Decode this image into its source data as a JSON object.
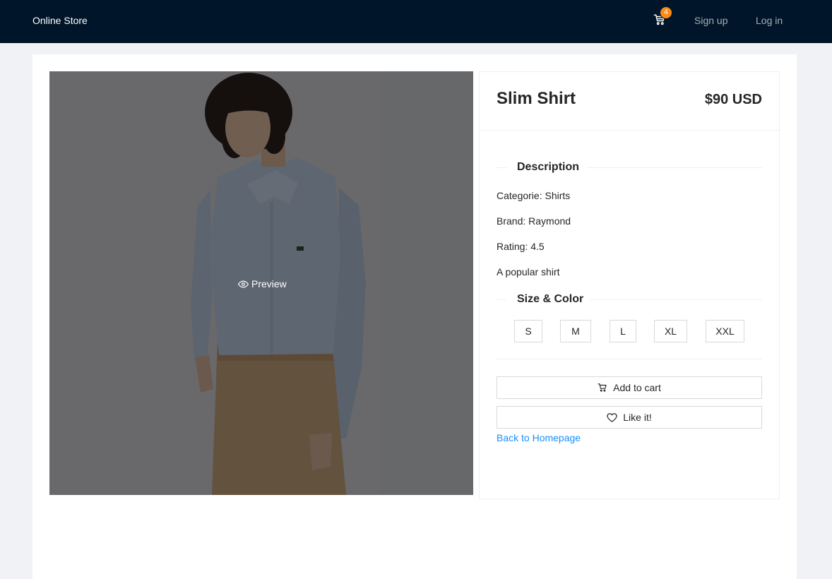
{
  "header": {
    "brand": "Online Store",
    "cart_count": "4",
    "signup_label": "Sign up",
    "login_label": "Log in"
  },
  "product": {
    "preview_label": "Preview",
    "title": "Slim Shirt",
    "price": "$90 USD",
    "description_heading": "Description",
    "category": "Categorie: Shirts",
    "brand": "Brand: Raymond",
    "rating": "Rating: 4.5",
    "summary": "A popular shirt",
    "size_heading": "Size & Color",
    "sizes": [
      "S",
      "M",
      "L",
      "XL",
      "XXL"
    ],
    "add_to_cart_label": "Add to cart",
    "like_label": "Like it!",
    "back_label": "Back to Homepage"
  },
  "colors": {
    "header_bg": "#001529",
    "badge": "#fa8c16",
    "link": "#1890ff",
    "page_bg": "#f0f2f5"
  },
  "icons": {
    "cart": "shopping-cart-icon",
    "preview": "eye-icon",
    "like": "heart-icon"
  }
}
